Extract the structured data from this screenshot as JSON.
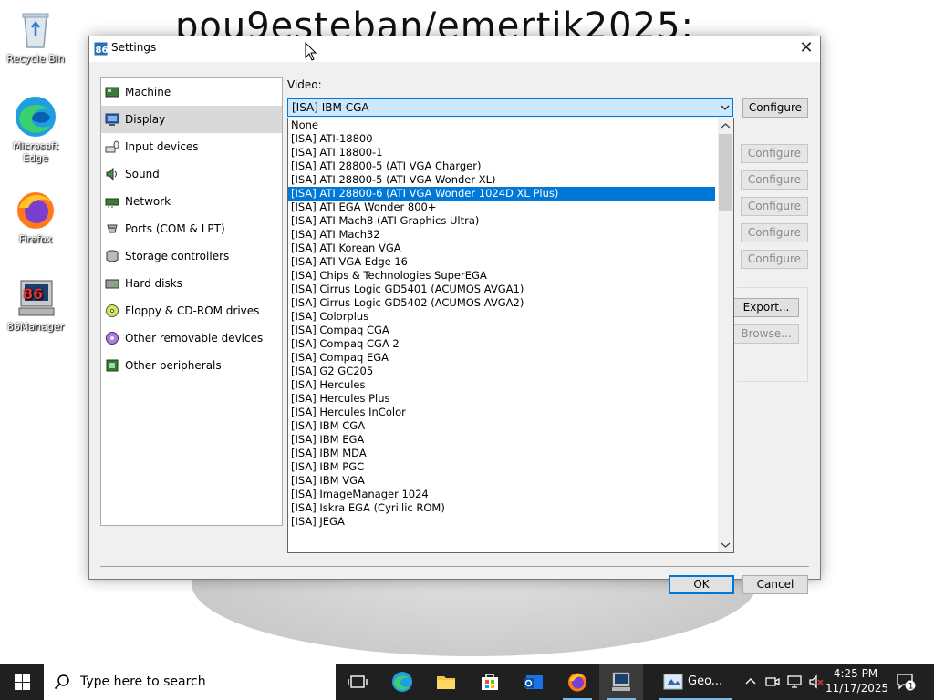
{
  "desktop": {
    "background_text": "pou9esteban/emertik2025:",
    "icons": [
      {
        "label": "Recycle Bin",
        "icon": "recycle-bin-icon"
      },
      {
        "label": "Microsoft Edge",
        "icon": "edge-icon"
      },
      {
        "label": "Firefox",
        "icon": "firefox-icon"
      },
      {
        "label": "86Manager",
        "icon": "86box-manager-icon"
      }
    ]
  },
  "window": {
    "title": "Settings",
    "close_glyph": "✕"
  },
  "nav": {
    "items": [
      {
        "label": "Machine",
        "icon": "machine-icon"
      },
      {
        "label": "Display",
        "icon": "display-icon"
      },
      {
        "label": "Input devices",
        "icon": "input-devices-icon"
      },
      {
        "label": "Sound",
        "icon": "sound-icon"
      },
      {
        "label": "Network",
        "icon": "network-icon"
      },
      {
        "label": "Ports (COM & LPT)",
        "icon": "ports-icon"
      },
      {
        "label": "Storage controllers",
        "icon": "storage-icon"
      },
      {
        "label": "Hard disks",
        "icon": "hard-disk-icon"
      },
      {
        "label": "Floppy & CD-ROM drives",
        "icon": "floppy-cdrom-icon"
      },
      {
        "label": "Other removable devices",
        "icon": "removable-icon"
      },
      {
        "label": "Other peripherals",
        "icon": "peripherals-icon"
      }
    ],
    "selected": "Display"
  },
  "display": {
    "video_label": "Video:",
    "video_value": "[ISA] IBM CGA",
    "configure_label": "Configure",
    "export_label": "Export...",
    "browse_label": "Browse...",
    "options": [
      "None",
      "[ISA] ATI-18800",
      "[ISA] ATI 18800-1",
      "[ISA] ATI 28800-5 (ATI VGA Charger)",
      "[ISA] ATI 28800-5 (ATI VGA Wonder XL)",
      "[ISA] ATI 28800-6 (ATI VGA Wonder 1024D XL Plus)",
      "[ISA] ATI EGA Wonder 800+",
      "[ISA] ATI Mach8 (ATI Graphics Ultra)",
      "[ISA] ATI Mach32",
      "[ISA] ATI Korean VGA",
      "[ISA] ATI VGA Edge 16",
      "[ISA] Chips & Technologies SuperEGA",
      "[ISA] Cirrus Logic GD5401 (ACUMOS AVGA1)",
      "[ISA] Cirrus Logic GD5402 (ACUMOS AVGA2)",
      "[ISA] Colorplus",
      "[ISA] Compaq CGA",
      "[ISA] Compaq CGA 2",
      "[ISA] Compaq EGA",
      "[ISA] G2 GC205",
      "[ISA] Hercules",
      "[ISA] Hercules Plus",
      "[ISA] Hercules InColor",
      "[ISA] IBM CGA",
      "[ISA] IBM EGA",
      "[ISA] IBM MDA",
      "[ISA] IBM PGC",
      "[ISA] IBM VGA",
      "[ISA] ImageManager 1024",
      "[ISA] Iskra EGA (Cyrillic ROM)",
      "[ISA] JEGA"
    ],
    "highlighted_option": "[ISA] ATI 28800-6 (ATI VGA Wonder 1024D XL Plus)"
  },
  "footer": {
    "ok_label": "OK",
    "cancel_label": "Cancel"
  },
  "taskbar": {
    "search_placeholder": "Type here to search",
    "active_app_label": "Geo...",
    "time": "4:25 PM",
    "date": "11/17/2025",
    "notification_count": "1"
  },
  "colors": {
    "accent": "#0078d7",
    "combo_bg": "#cce8ff",
    "taskbar": "#202020",
    "dialog_bg": "#f0f0f0"
  }
}
